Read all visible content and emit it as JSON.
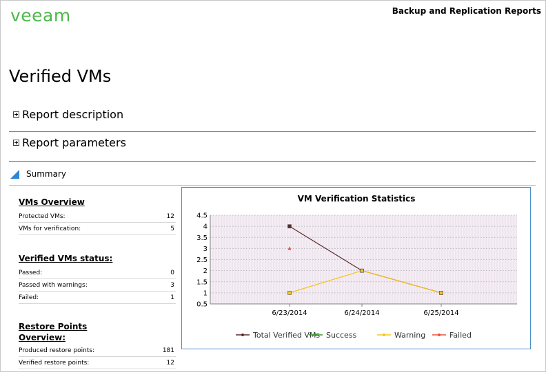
{
  "header": {
    "logo_text": "veeam",
    "report_suite": "Backup and Replication Reports"
  },
  "page": {
    "title": "Verified VMs"
  },
  "sections": {
    "report_description": "Report description",
    "report_parameters": "Report parameters",
    "summary": "Summary"
  },
  "vms_overview": {
    "heading": "VMs Overview",
    "rows": [
      {
        "label": "Protected VMs:",
        "value": "12"
      },
      {
        "label": "VMs for verification:",
        "value": "5"
      }
    ]
  },
  "verified_status": {
    "heading": "Verified VMs status:",
    "rows": [
      {
        "label": "Passed:",
        "value": "0"
      },
      {
        "label": "Passed with warnings:",
        "value": "3"
      },
      {
        "label": "Failed:",
        "value": "1"
      }
    ]
  },
  "restore_points": {
    "heading_line1": "Restore Points",
    "heading_line2": "Overview:",
    "rows": [
      {
        "label": "Produced restore points:",
        "value": "181"
      },
      {
        "label": "Verified restore points:",
        "value": "12"
      }
    ]
  },
  "colors": {
    "accent_blue": "#2c87d8",
    "brand_green": "#4cb848"
  },
  "chart_data": {
    "type": "line",
    "title": "VM Verification Statistics",
    "x": [
      "6/23/2014",
      "6/24/2014",
      "6/25/2014"
    ],
    "ylim": [
      0.5,
      4.5
    ],
    "yticks": [
      "0.5",
      "1",
      "1.5",
      "2",
      "2.5",
      "3",
      "3.5",
      "4",
      "4.5"
    ],
    "grid": true,
    "legend_position": "bottom",
    "series": [
      {
        "name": "Total Verified VMs",
        "color": "#5a2a2a",
        "values": [
          4,
          2,
          1
        ]
      },
      {
        "name": "Success",
        "color": "#3a9a2a",
        "values": [
          null,
          null,
          null
        ]
      },
      {
        "name": "Warning",
        "color": "#f5c518",
        "values": [
          1,
          2,
          1
        ]
      },
      {
        "name": "Failed",
        "color": "#e8503a",
        "values": [
          3,
          null,
          null
        ]
      }
    ]
  }
}
